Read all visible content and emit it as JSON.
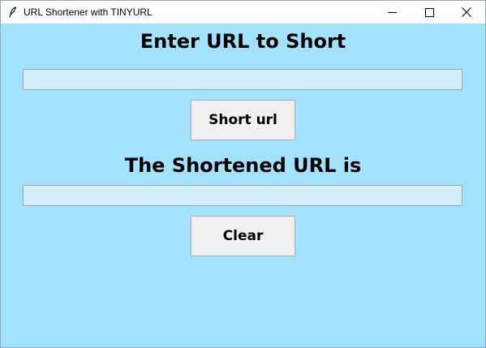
{
  "window": {
    "title": "URL Shortener with TINYURL",
    "background_color": "#a2e2fd",
    "icons": {
      "app": "feather-icon",
      "minimize": "minimize-icon",
      "maximize": "maximize-icon",
      "close": "close-icon"
    }
  },
  "input_section": {
    "heading": "Enter URL to Short",
    "url_value": "",
    "button_label": "Short url"
  },
  "output_section": {
    "heading": "The Shortened URL is",
    "short_url_value": "",
    "button_label": "Clear"
  }
}
